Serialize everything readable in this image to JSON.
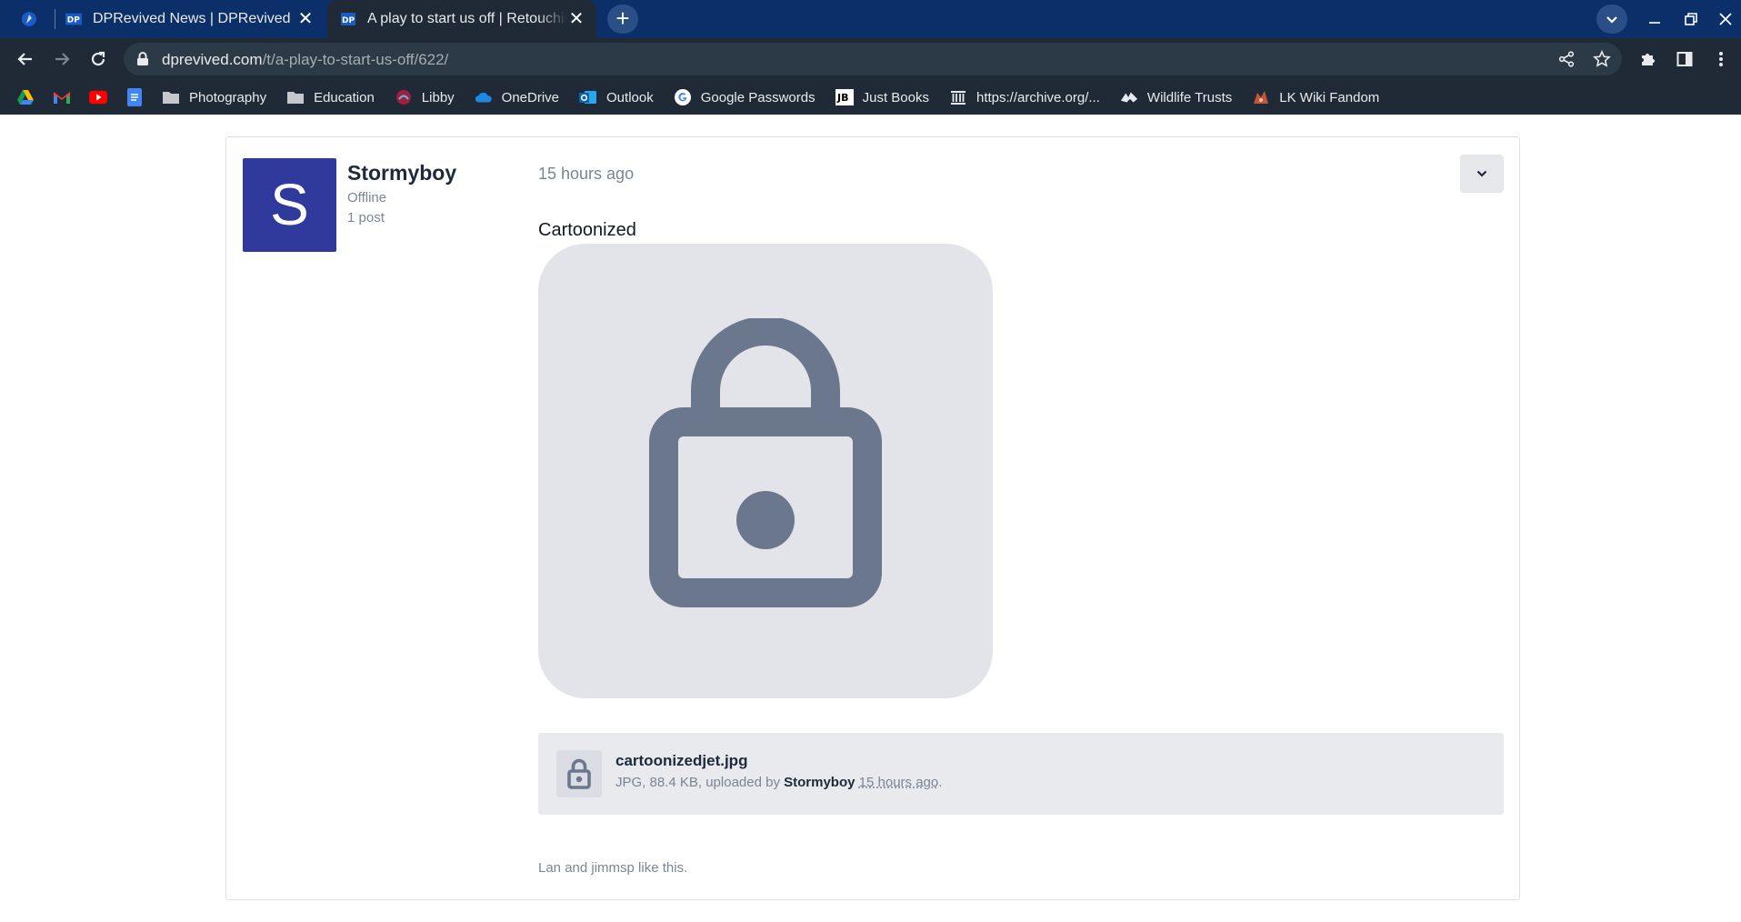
{
  "browser": {
    "tabs": [
      {
        "title": "DPRevived News | DPRevived",
        "close": "✕"
      },
      {
        "title": "A play to start us off | Retouching",
        "close": "✕"
      }
    ],
    "new_tab": "+",
    "address": {
      "host": "dprevived.com",
      "path": "/t/a-play-to-start-us-off/622/"
    },
    "bookmarks": [
      "Photography",
      "Education",
      "Libby",
      "OneDrive",
      "Outlook",
      "Google Passwords",
      "Just Books",
      "https://archive.org/...",
      "Wildlife Trusts",
      "LK Wiki Fandom"
    ],
    "colors": {
      "tabstrip": "#0b2f68",
      "toolbar": "#1f2a36",
      "active_tab": "#1f2a36"
    }
  },
  "post": {
    "avatar_letter": "S",
    "username": "Stormyboy",
    "status": "Offline",
    "post_count": "1 post",
    "timestamp": "15 hours ago",
    "caption": "Cartoonized",
    "attachment": {
      "filename": "cartoonizedjet.jpg",
      "meta_prefix": "JPG, 88.4 KB, uploaded by",
      "uploader": "Stormyboy",
      "uploaded_when": "15 hours ago",
      "meta_suffix": "."
    },
    "likes_text": "Lan and jimmsp like this.",
    "colors": {
      "avatar": "#2f3a9c",
      "placeholder": "#e2e4e9",
      "lock_icon": "#6b778c"
    }
  }
}
